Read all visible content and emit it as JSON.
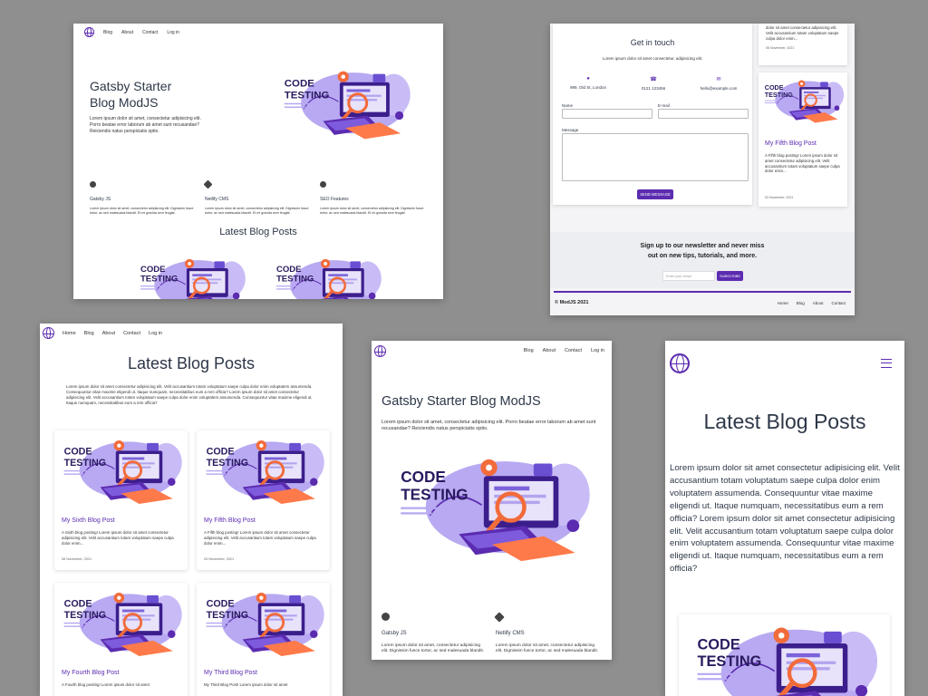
{
  "colors": {
    "accent": "#5b2bb0",
    "background": "#8f8f8f"
  },
  "art": {
    "title_line1": "CODE",
    "title_line2": "TESTING"
  },
  "s1": {
    "nav": [
      "Blog",
      "About",
      "Contact",
      "Log in"
    ],
    "hero_title": "Gatsby Starter Blog ModJS",
    "hero_text": "Lorem ipsum dolor sit amet, consectetur adipisicing elit. Porro beatae error laborum ab amet sunt recusandae? Reiciendis natus perspiciatis optio.",
    "features": [
      {
        "icon": "github-icon",
        "title": "Gatsby JS",
        "text": "Lorem ipsum dolor sit amet, consectetur adipisicing elit. Dignissim fusce tortor, ac sed malesuada blandit. Et mi gravida sem feugiat."
      },
      {
        "icon": "netlify-icon",
        "title": "Netlify CMS",
        "text": "Lorem ipsum dolor sit amet, consectetur adipisicing elit. Dignissim fusce tortor, ac sed malesuada blandit. Et mi gravida sem feugiat."
      },
      {
        "icon": "shield-icon",
        "title": "SEO Features",
        "text": "Lorem ipsum dolor sit amet, consectetur adipisicing elit. Dignissim fusce tortor, ac sed malesuada blandit. Et mi gravida sem feugiat."
      }
    ],
    "latest_heading": "Latest Blog Posts"
  },
  "s2": {
    "heading": "Get in touch",
    "subtext": "Lorem ipsum dolor sit amet consectetur, adipisicing elit.",
    "address": "999, Old St, London",
    "phone": "0121 123456",
    "email": "hello@example.com",
    "name_label": "Name",
    "email_label": "E-mail",
    "message_label": "Message",
    "send_label": "SEND MESSAGE",
    "side_top_text": "dolor sit amet consectetur adipisicing elit. Velit accusantium totam voluptatum saepe culpa dolor enim...",
    "side_top_date": "06 November, 2021",
    "side_post_title": "My Fifth Blog Post",
    "side_post_text": "A Fifth blog posting! Lorem ipsum dolor sit amet consectetur adipisicing elit. Velit accusantium totam voluptatum saepe culpa dolor enim...",
    "side_post_date": "03 November, 2021",
    "newsletter_line1": "Sign up to our newsletter and never miss",
    "newsletter_line2": "out on new tips, tutorials, and more.",
    "newsletter_placeholder": "Enter your email",
    "subscribe_label": "SUBSCRIBE",
    "copyright": "© ModJS 2021",
    "footer_links": [
      "Home",
      "Blog",
      "About",
      "Contact"
    ]
  },
  "s3": {
    "nav": [
      "Home",
      "Blog",
      "About",
      "Contact",
      "Log in"
    ],
    "heading": "Latest Blog Posts",
    "intro": "Lorem ipsum dolor sit amet consectetur adipisicing elit. Velit accusantium totam voluptatum saepe culpa dolor enim voluptatem assumenda. Consequuntur vitae maxime eligendi ut. Itaque numquam, necessitatibus eum a rem officia? Lorem ipsum dolor sit amet consectetur adipisicing elit. Velit accusantium totam voluptatum saepe culpa dolor enim voluptatem assumenda. Consequuntur vitae maxime eligendi ut. Itaque numquam, necessitatibus eum a rem officia?",
    "posts": [
      {
        "title": "My Sixth Blog Post",
        "text": "A Sixth blog posting! Lorem ipsum dolor sit amet consectetur adipisicing elit. Velit accusantium totam voluptatum saepe culpa dolor enim...",
        "date": "08 November, 2021"
      },
      {
        "title": "My Fifth Blog Post",
        "text": "A Fifth blog posting! Lorem ipsum dolor sit amet consectetur adipisicing elit. Velit accusantium totam voluptatum saepe culpa dolor enim...",
        "date": "03 November, 2021"
      },
      {
        "title": "My Fourth Blog Post",
        "text": "A Fourth blog posting! Lorem ipsum dolor sit amet",
        "date": ""
      },
      {
        "title": "My Third Blog Post",
        "text": "My Third Blog Post! Lorem ipsum dolor sit amet",
        "date": ""
      }
    ]
  },
  "s4": {
    "nav": [
      "Blog",
      "About",
      "Contact",
      "Log in"
    ],
    "hero_title": "Gatsby Starter Blog ModJS",
    "hero_text": "Lorem ipsum dolor sit amet, consectetur adipisicing elit. Porro beatae error laborum ab amet sunt recusandae? Reiciendis natus perspiciatis optio.",
    "features": [
      {
        "title": "Gatsby JS",
        "text": "Lorem ipsum dolor sit amet, consectetur adipisicing elit. Dignissim fusce tortor, ac sed malesuada blandit."
      },
      {
        "title": "Netlify CMS",
        "text": "Lorem ipsum dolor sit amet, consectetur adipisicing elit. Dignissim fusce tortor, ac sed malesuada blandit."
      }
    ]
  },
  "s5": {
    "heading": "Latest Blog Posts",
    "intro": "Lorem ipsum dolor sit amet consectetur adipisicing elit. Velit accusantium totam voluptatum saepe culpa dolor enim voluptatem assumenda. Consequuntur vitae maxime eligendi ut. Itaque numquam, necessitatibus eum a rem officia? Lorem ipsum dolor sit amet consectetur adipisicing elit. Velit accusantium totam voluptatum saepe culpa dolor enim voluptatem assumenda. Consequuntur vitae maxime eligendi ut. Itaque numquam, necessitatibus eum a rem officia?"
  }
}
